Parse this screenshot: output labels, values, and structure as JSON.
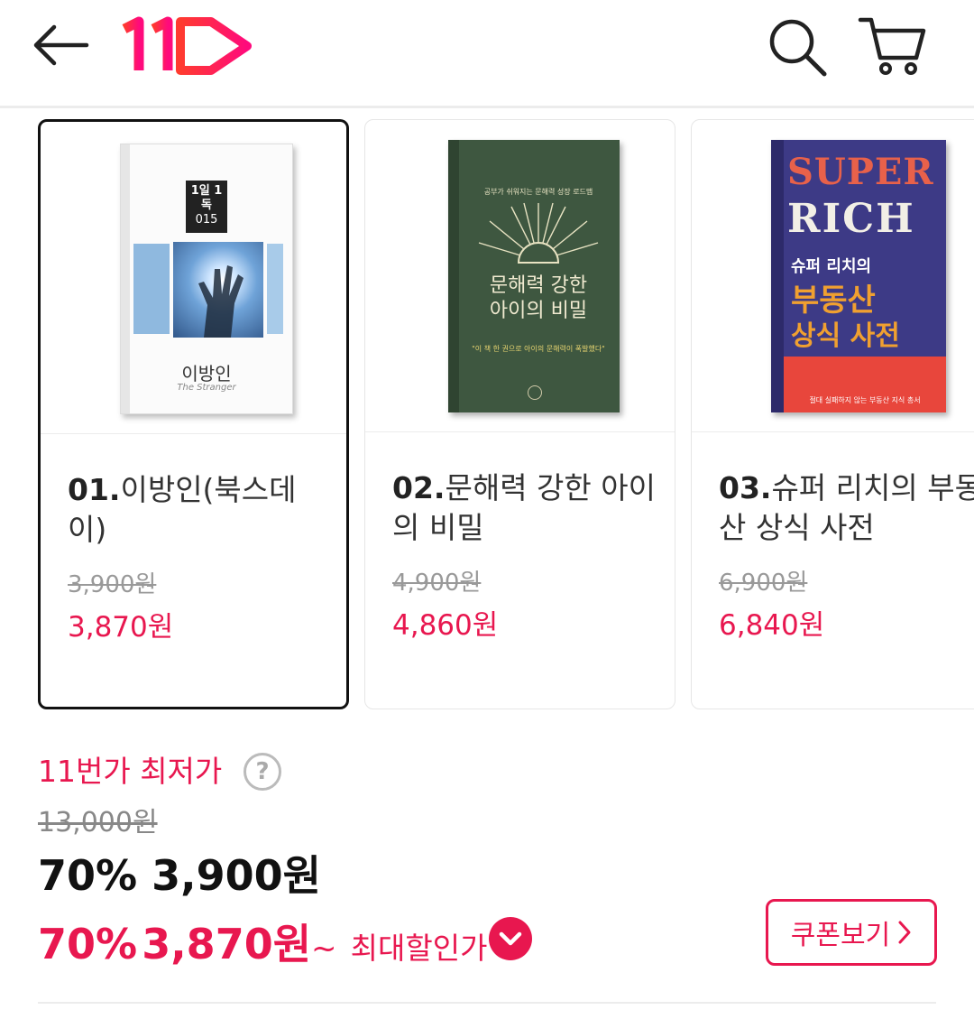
{
  "header": {
    "back_icon": "arrow-left-icon",
    "logo_text": "11",
    "search_icon": "search-icon",
    "cart_icon": "cart-icon"
  },
  "products": [
    {
      "rank": "01.",
      "title": "이방인(북스데이)",
      "original_price": "3,900원",
      "sale_price": "3,870원",
      "selected": true,
      "cover": {
        "series": "1일 1독",
        "series_no": "015",
        "title": "이방인",
        "subtitle": "The Stranger"
      }
    },
    {
      "rank": "02.",
      "title": "문해력 강한 아이의 비밀",
      "original_price": "4,900원",
      "sale_price": "4,860원",
      "selected": false,
      "cover": {
        "tagline": "공부가 쉬워지는 문해력 성장 로드맵",
        "title_line1": "문해력 강한",
        "title_line2": "아이의 비밀",
        "quote": "\"이 책 한 권으로 아이의 문해력이 폭발했다\""
      }
    },
    {
      "rank": "03.",
      "title": "슈퍼 리치의 부동산 상식 사전",
      "original_price": "6,900원",
      "sale_price": "6,840원",
      "selected": false,
      "cover": {
        "big_line1": "SUPER",
        "big_line2": "RICH",
        "ko_line1": "슈퍼 리치의",
        "ko_line2": "부동산",
        "ko_line3": "상식 사전",
        "bottom": "절대 실패하지 않는 부동산 지식 총서"
      }
    }
  ],
  "price": {
    "lowest_label": "11번가 최저가",
    "help_icon": "?",
    "list_price": "13,000원",
    "discount_pct": "70%",
    "price": "3,900원",
    "max_discount_pct": "70%",
    "max_price": "3,870원",
    "max_suffix": "~",
    "max_label": "최대할인가",
    "coupon_label": "쿠폰보기"
  },
  "colors": {
    "accent": "#e8174f",
    "logo_gradient_start": "#ff3b30",
    "logo_gradient_end": "#ff0a7a"
  }
}
